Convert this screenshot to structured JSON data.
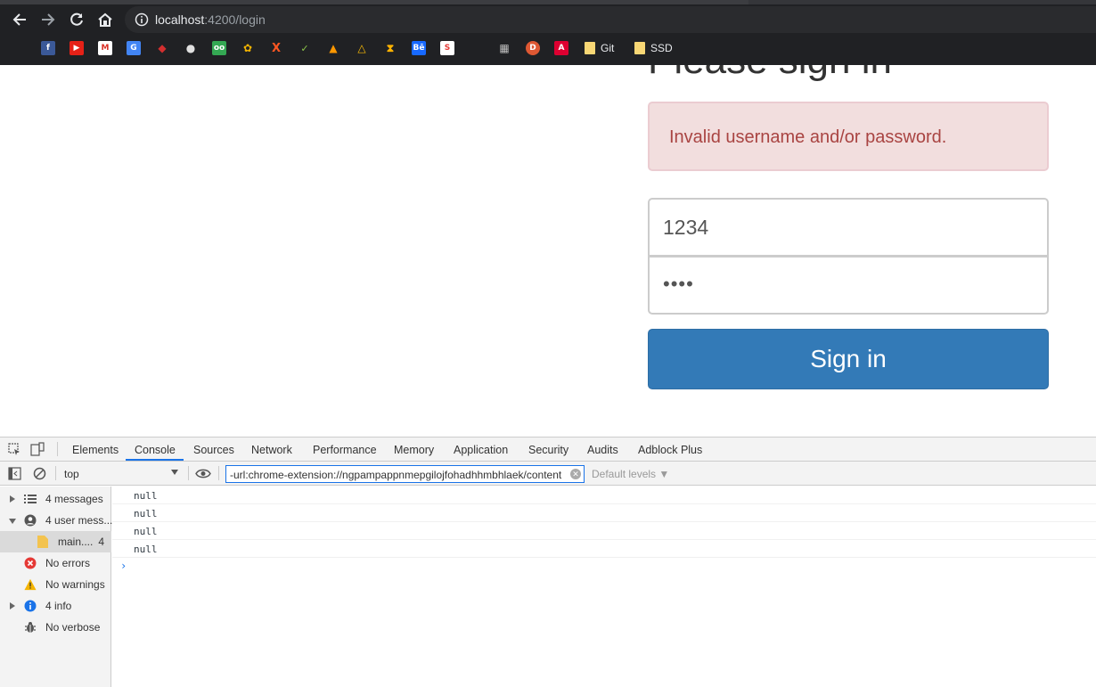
{
  "browser": {
    "url_host": "localhost",
    "url_rest": ":4200/login",
    "bookmark_folders": [
      {
        "label": "Git"
      },
      {
        "label": "SSD"
      }
    ]
  },
  "page": {
    "heading": "Please sign in",
    "alert_text": "Invalid username and/or password.",
    "username_value": "1234",
    "password_value": "••••",
    "signin_label": "Sign in"
  },
  "devtools": {
    "tabs": [
      "Elements",
      "Console",
      "Sources",
      "Network",
      "Performance",
      "Memory",
      "Application",
      "Security",
      "Audits",
      "Adblock Plus"
    ],
    "active_tab": "Console",
    "context": "top",
    "filter_value": "-url:chrome-extension://ngpampappnmepgilojfohadhhmbhlaek/content",
    "levels_label": "Default levels ▼",
    "sidebar": [
      {
        "label": "4 messages"
      },
      {
        "label": "4 user mess..."
      },
      {
        "label": "main....",
        "count": "4"
      },
      {
        "label": "No errors"
      },
      {
        "label": "No warnings"
      },
      {
        "label": "4 info"
      },
      {
        "label": "No verbose"
      }
    ],
    "logs": [
      "null",
      "null",
      "null",
      "null"
    ],
    "prompt": "›"
  },
  "colors": {
    "primary": "#337ab7",
    "alert_bg": "#f2dede",
    "alert_text": "#a94442",
    "devtools_accent": "#1a73e8"
  }
}
